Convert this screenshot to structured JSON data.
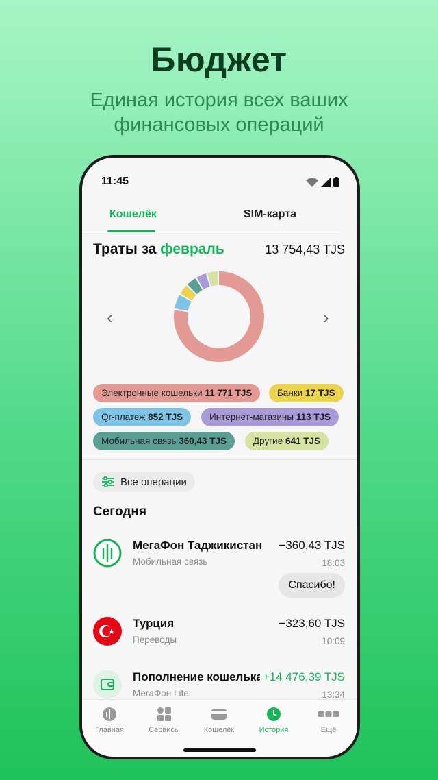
{
  "promo": {
    "headline": "Бюджет",
    "subline_1": "Единая история всех ваших",
    "subline_2": "финансовых операций"
  },
  "status_bar": {
    "time": "11:45"
  },
  "tabs": {
    "wallet": "Кошелёк",
    "sim": "SIM-карта"
  },
  "spending": {
    "title_prefix": "Траты за",
    "month": "февраль",
    "total": "13 754,43 TJS"
  },
  "chart_data": {
    "type": "pie",
    "donut": true,
    "segments": [
      {
        "label": "Электронные кошельки",
        "value": 11771,
        "color": "#e39a94"
      },
      {
        "label": "Qr-платеж",
        "value": 852,
        "color": "#7fc4e6"
      },
      {
        "label": "Банки",
        "value": 17,
        "color": "#ecd34d"
      },
      {
        "label": "Мобильная связь",
        "value": 360.43,
        "color": "#5b9e93"
      },
      {
        "label": "Интернет-магазины",
        "value": 113,
        "color": "#a89bd8"
      },
      {
        "label": "Другие",
        "value": 641,
        "color": "#d7e3a3"
      }
    ]
  },
  "categories": [
    {
      "label": "Электронные кошельки",
      "amount": "11 771 TJS",
      "color": "#e39a94"
    },
    {
      "label": "Банки",
      "amount": "17 TJS",
      "color": "#ecd34d"
    },
    {
      "label": "Qr-платеж",
      "amount": "852 TJS",
      "color": "#7fc4e6"
    },
    {
      "label": "Интернет-магазины",
      "amount": "113 TJS",
      "color": "#a89bd8"
    },
    {
      "label": "Мобильная связь",
      "amount": "360,43 TJS",
      "color": "#5b9e93"
    },
    {
      "label": "Другие",
      "amount": "641 TJS",
      "color": "#d7e3a3"
    }
  ],
  "filter_label": "Все операции",
  "section_today": "Сегодня",
  "transactions": [
    {
      "name": "МегаФон Таджикистан",
      "category": "Мобильная связь",
      "amount": "−360,43 TJS",
      "time": "18:03",
      "icon": "megafon-logo-icon"
    },
    {
      "name": "Турция",
      "category": "Переводы",
      "amount": "−323,60 TJS",
      "time": "10:09",
      "icon": "turkey-flag-icon"
    },
    {
      "name": "Пополнение кошелька",
      "category": "МегаФон Life",
      "amount": "+14 476,39 TJS",
      "time": "13:34",
      "icon": "wallet-icon"
    }
  ],
  "bubble": "Спасибо!",
  "tabbar": [
    {
      "label": "Главная",
      "icon": "home-icon"
    },
    {
      "label": "Сервисы",
      "icon": "services-icon"
    },
    {
      "label": "Кошелёк",
      "icon": "wallet-icon"
    },
    {
      "label": "История",
      "icon": "history-clock-icon",
      "active": true
    },
    {
      "label": "Ещё",
      "icon": "more-icon"
    }
  ],
  "colors": {
    "accent": "#15b45a",
    "headline": "#0e3d20"
  }
}
